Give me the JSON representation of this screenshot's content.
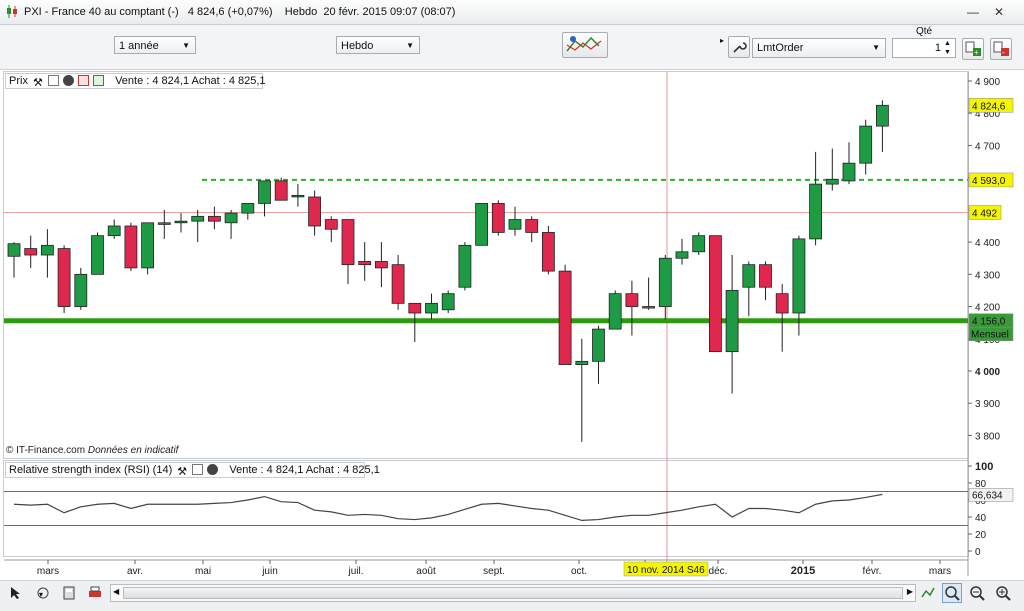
{
  "window": {
    "title": "PXI - France 40 au comptant (-)",
    "price": "4 824,6",
    "change": "(+0,07%)",
    "interval": "Hebdo",
    "datetime": "20 févr. 2015 09:07 (08:07)"
  },
  "toolbar": {
    "period_value": "1 année",
    "interval_value": "Hebdo",
    "order_type_value": "LmtOrder",
    "qty_label": "Qté",
    "qty_value": "1"
  },
  "price_panel": {
    "title": "Prix",
    "quote": "Vente : 4 824,1 Achat : 4 825,1",
    "footnote_source": "© IT-Finance.com",
    "footnote_note": "Données en indicatif"
  },
  "rsi_panel": {
    "title": "Relative strength index (RSI) (14)",
    "quote": "Vente : 4 824,1 Achat : 4 825,1"
  },
  "chart_data": [
    {
      "type": "candlestick",
      "ylim": [
        3750,
        4950
      ],
      "yticks": [
        "3 800",
        "3 900",
        "4 000",
        "4 100",
        "4 200",
        "4 300",
        "4 400",
        "4 500",
        "4 600",
        "4 700",
        "4 800",
        "4 900"
      ],
      "xticks": [
        "mars",
        "avr.",
        "mai",
        "juin",
        "juil.",
        "août",
        "sept.",
        "oct.",
        "nov.",
        "déc.",
        "2015",
        "févr.",
        "mars"
      ],
      "cursor_date": "10 nov. 2014 S46",
      "markers": [
        {
          "label": "4 824,6",
          "value": 4824.6,
          "color": "#f5f500"
        },
        {
          "label": "4 593,0",
          "value": 4593,
          "color": "#f5f500"
        },
        {
          "label": "4 492",
          "value": 4492,
          "color": "#f5f500"
        },
        {
          "label": "4 156,0",
          "value": 4156,
          "color": "#3a9a3a"
        },
        {
          "label": "Mensuel",
          "value": 4156,
          "color": "#3a9a3a"
        }
      ],
      "hlines": [
        {
          "value": 4593,
          "style": "dashed",
          "color": "#2db02d"
        },
        {
          "value": 4156,
          "style": "solid",
          "color": "#2e9a10"
        },
        {
          "value": 4492,
          "style": "thin",
          "color": "#f0a0a0"
        }
      ],
      "candles": [
        {
          "o": 4356,
          "h": 4400,
          "l": 4290,
          "c": 4395
        },
        {
          "o": 4380,
          "h": 4420,
          "l": 4320,
          "c": 4360
        },
        {
          "o": 4360,
          "h": 4440,
          "l": 4290,
          "c": 4390
        },
        {
          "o": 4380,
          "h": 4390,
          "l": 4180,
          "c": 4200
        },
        {
          "o": 4200,
          "h": 4320,
          "l": 4190,
          "c": 4300
        },
        {
          "o": 4300,
          "h": 4430,
          "l": 4300,
          "c": 4420
        },
        {
          "o": 4420,
          "h": 4470,
          "l": 4410,
          "c": 4450
        },
        {
          "o": 4450,
          "h": 4460,
          "l": 4310,
          "c": 4320
        },
        {
          "o": 4320,
          "h": 4460,
          "l": 4300,
          "c": 4460
        },
        {
          "o": 4455,
          "h": 4500,
          "l": 4410,
          "c": 4460
        },
        {
          "o": 4460,
          "h": 4490,
          "l": 4430,
          "c": 4465
        },
        {
          "o": 4465,
          "h": 4500,
          "l": 4400,
          "c": 4480
        },
        {
          "o": 4480,
          "h": 4510,
          "l": 4440,
          "c": 4465
        },
        {
          "o": 4460,
          "h": 4500,
          "l": 4410,
          "c": 4490
        },
        {
          "o": 4490,
          "h": 4520,
          "l": 4470,
          "c": 4520
        },
        {
          "o": 4520,
          "h": 4590,
          "l": 4480,
          "c": 4590
        },
        {
          "o": 4590,
          "h": 4600,
          "l": 4530,
          "c": 4530
        },
        {
          "o": 4545,
          "h": 4580,
          "l": 4510,
          "c": 4545
        },
        {
          "o": 4540,
          "h": 4560,
          "l": 4420,
          "c": 4450
        },
        {
          "o": 4470,
          "h": 4480,
          "l": 4400,
          "c": 4440
        },
        {
          "o": 4470,
          "h": 4470,
          "l": 4270,
          "c": 4330
        },
        {
          "o": 4340,
          "h": 4400,
          "l": 4280,
          "c": 4330
        },
        {
          "o": 4340,
          "h": 4400,
          "l": 4260,
          "c": 4320
        },
        {
          "o": 4330,
          "h": 4360,
          "l": 4190,
          "c": 4210
        },
        {
          "o": 4210,
          "h": 4210,
          "l": 4090,
          "c": 4180
        },
        {
          "o": 4180,
          "h": 4240,
          "l": 4160,
          "c": 4210
        },
        {
          "o": 4190,
          "h": 4250,
          "l": 4180,
          "c": 4240
        },
        {
          "o": 4260,
          "h": 4400,
          "l": 4250,
          "c": 4390
        },
        {
          "o": 4390,
          "h": 4520,
          "l": 4390,
          "c": 4520
        },
        {
          "o": 4520,
          "h": 4530,
          "l": 4420,
          "c": 4430
        },
        {
          "o": 4440,
          "h": 4510,
          "l": 4420,
          "c": 4470
        },
        {
          "o": 4470,
          "h": 4480,
          "l": 4400,
          "c": 4430
        },
        {
          "o": 4430,
          "h": 4450,
          "l": 4300,
          "c": 4310
        },
        {
          "o": 4310,
          "h": 4330,
          "l": 4020,
          "c": 4020
        },
        {
          "o": 4020,
          "h": 4100,
          "l": 3780,
          "c": 4030
        },
        {
          "o": 4030,
          "h": 4140,
          "l": 3960,
          "c": 4130
        },
        {
          "o": 4130,
          "h": 4250,
          "l": 4130,
          "c": 4240
        },
        {
          "o": 4240,
          "h": 4280,
          "l": 4110,
          "c": 4200
        },
        {
          "o": 4200,
          "h": 4290,
          "l": 4190,
          "c": 4200
        },
        {
          "o": 4200,
          "h": 4360,
          "l": 4160,
          "c": 4350
        },
        {
          "o": 4350,
          "h": 4410,
          "l": 4330,
          "c": 4370
        },
        {
          "o": 4370,
          "h": 4430,
          "l": 4360,
          "c": 4420
        },
        {
          "o": 4420,
          "h": 4420,
          "l": 4060,
          "c": 4060
        },
        {
          "o": 4060,
          "h": 4360,
          "l": 3930,
          "c": 4250
        },
        {
          "o": 4260,
          "h": 4340,
          "l": 4170,
          "c": 4330
        },
        {
          "o": 4330,
          "h": 4340,
          "l": 4220,
          "c": 4260
        },
        {
          "o": 4240,
          "h": 4270,
          "l": 4060,
          "c": 4180
        },
        {
          "o": 4180,
          "h": 4420,
          "l": 4110,
          "c": 4410
        },
        {
          "o": 4410,
          "h": 4680,
          "l": 4390,
          "c": 4580
        },
        {
          "o": 4580,
          "h": 4690,
          "l": 4560,
          "c": 4595
        },
        {
          "o": 4590,
          "h": 4710,
          "l": 4580,
          "c": 4645
        },
        {
          "o": 4645,
          "h": 4780,
          "l": 4610,
          "c": 4760
        },
        {
          "o": 4760,
          "h": 4840,
          "l": 4680,
          "c": 4824.6
        }
      ]
    },
    {
      "type": "line",
      "name": "RSI (14)",
      "ylim": [
        0,
        100
      ],
      "yticks": [
        "100",
        "80",
        "60",
        "40",
        "20",
        "0"
      ],
      "marker_label": "66,634",
      "hlines": [
        70,
        30
      ],
      "values": [
        55,
        54,
        55,
        45,
        52,
        55,
        56,
        50,
        55,
        55,
        55,
        55,
        56,
        57,
        60,
        64,
        58,
        57,
        48,
        46,
        42,
        43,
        42,
        38,
        37,
        39,
        43,
        49,
        55,
        56,
        53,
        50,
        48,
        42,
        36,
        37,
        40,
        42,
        42,
        45,
        48,
        52,
        55,
        40,
        50,
        50,
        48,
        45,
        55,
        59,
        60,
        63,
        66.634
      ]
    }
  ]
}
